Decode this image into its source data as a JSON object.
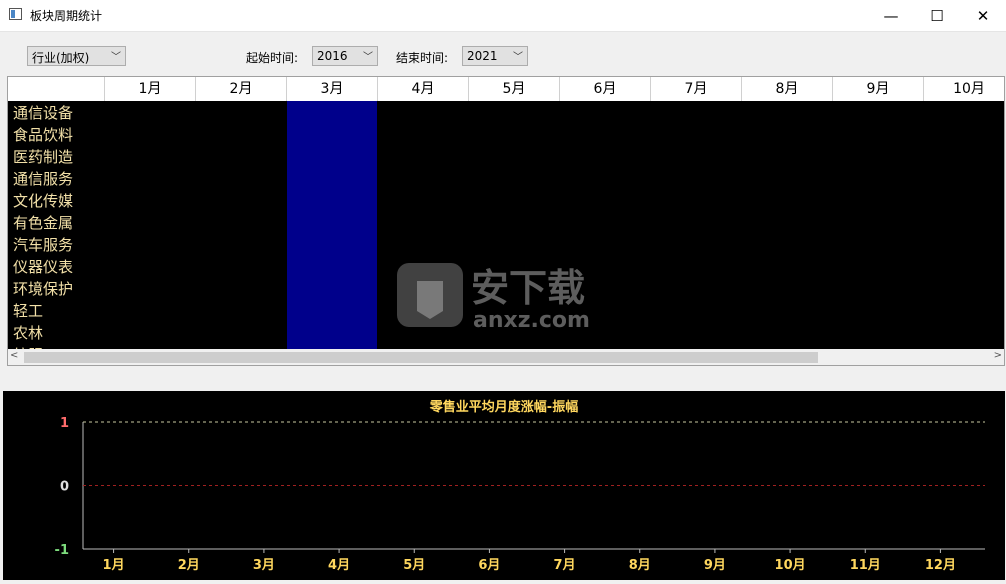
{
  "window": {
    "title": "板块周期统计"
  },
  "toolbar": {
    "category": "行业(加权)",
    "start_label": "起始时间:",
    "start_year": "2016",
    "end_label": "结束时间:",
    "end_year": "2021"
  },
  "grid": {
    "months": [
      "1月",
      "2月",
      "3月",
      "4月",
      "5月",
      "6月",
      "7月",
      "8月",
      "9月",
      "10月"
    ],
    "rows": [
      "通信设备",
      "食品饮料",
      "医药制造",
      "通信服务",
      "文化传媒",
      "有色金属",
      "汽车服务",
      "仪器仪表",
      "环境保护",
      "轻工",
      "农林",
      "纺服"
    ]
  },
  "chart_data": {
    "type": "line",
    "title": "零售业平均月度涨幅-振幅",
    "categories": [
      "1月",
      "2月",
      "3月",
      "4月",
      "5月",
      "6月",
      "7月",
      "8月",
      "9月",
      "10月",
      "11月",
      "12月"
    ],
    "ylim": [
      -1,
      1
    ],
    "yticks": [
      "1",
      "0",
      "-1"
    ],
    "series": [],
    "grid": true,
    "colors": {
      "title": "#ffd75e",
      "xtick": "#ffd75e",
      "ytick_pos": "#ff6b6b",
      "ytick_zero": "#e0e0e0",
      "ytick_neg": "#7ddc7d",
      "gridline_top": "#c7c7a0",
      "gridline_zero": "#a02020"
    }
  },
  "watermark": {
    "text": "安下载",
    "sub": "anxz.com"
  }
}
